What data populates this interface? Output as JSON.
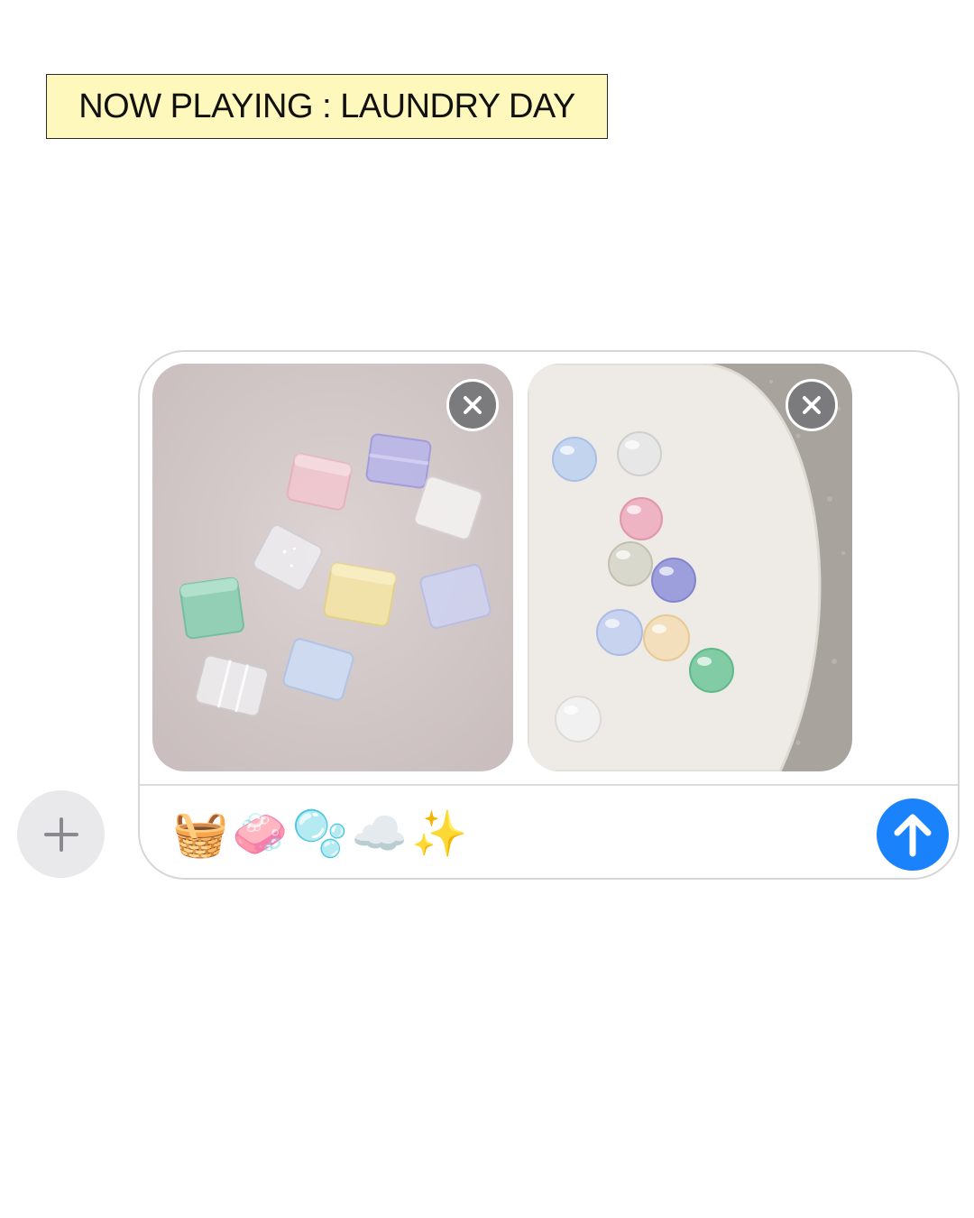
{
  "header": {
    "now_playing_label": "NOW PLAYING : LAUNDRY DAY",
    "label_background": "#fff8bd"
  },
  "composer": {
    "message_text": "🧺🧼🫧☁️✨",
    "attachments": [
      {
        "name": "glass tiles photo",
        "remove_icon": "close-icon"
      },
      {
        "name": "glass pebbles photo",
        "remove_icon": "close-icon"
      }
    ],
    "add_icon": "plus-icon",
    "send_icon": "arrow-up-icon",
    "send_color": "#1a82fb"
  }
}
